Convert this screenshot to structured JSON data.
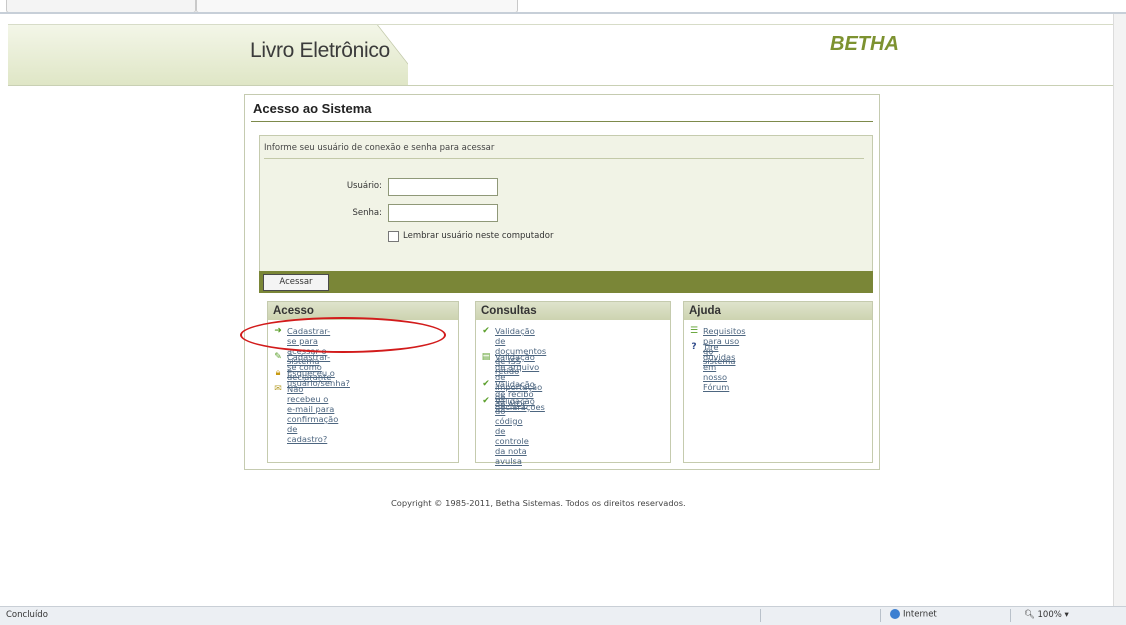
{
  "header": {
    "app_title": "Livro Eletrônico",
    "brand": "BETHA"
  },
  "page": {
    "section_title": "Acesso ao Sistema",
    "login": {
      "intro": "Informe seu usuário de conexão e senha para acessar",
      "user_label": "Usuário:",
      "password_label": "Senha:",
      "user_value": "",
      "password_value": "",
      "remember_label": "Lembrar usuário neste computador",
      "remember_checked": false,
      "submit_label": "Acessar"
    },
    "boxes": {
      "acesso": {
        "title": "Acesso",
        "items": [
          {
            "icon": "user-add-icon",
            "text_line1": "Cadastrar-se para acessar o",
            "text_line2": "sistema"
          },
          {
            "icon": "register-icon",
            "text_line1": "Cadastrar-se como declarante",
            "text_line2": ""
          },
          {
            "icon": "lock-icon",
            "text_line1": "Esqueceu o usuário/senha?",
            "text_line2": ""
          },
          {
            "icon": "email-icon",
            "text_line1": "Não recebeu o e-mail para",
            "text_line2": "confirmação de cadastro?"
          }
        ]
      },
      "consultas": {
        "title": "Consultas",
        "items": [
          {
            "icon": "check-icon",
            "text_line1": "Validação de documentos de ISS",
            "text_line2": "retido"
          },
          {
            "icon": "document-check-icon",
            "text_line1": "Validação de arquivo de",
            "text_line2": "importação de declarações"
          },
          {
            "icon": "check-icon",
            "text_line1": "Validação de recibo de AIDF",
            "text_line2": ""
          },
          {
            "icon": "check-icon",
            "text_line1": "Validação do código de controle",
            "text_line2": "da nota avulsa"
          }
        ]
      },
      "ajuda": {
        "title": "Ajuda",
        "items": [
          {
            "icon": "list-icon",
            "text_line1": "Requisitos para uso do sistema",
            "text_line2": ""
          },
          {
            "icon": "help-icon",
            "text_line1": "Tire dúvidas em nosso Fórum",
            "text_line2": ""
          }
        ]
      }
    },
    "copyright": "Copyright © 1985-2011, Betha Sistemas. Todos os direitos reservados."
  },
  "statusbar": {
    "status": "Concluído",
    "zone": "Internet",
    "zoom": "100%"
  },
  "colors": {
    "brand": "#7d9230",
    "bar": "#7a8637",
    "link": "#4d6680",
    "highlight": "#d21b1b"
  }
}
